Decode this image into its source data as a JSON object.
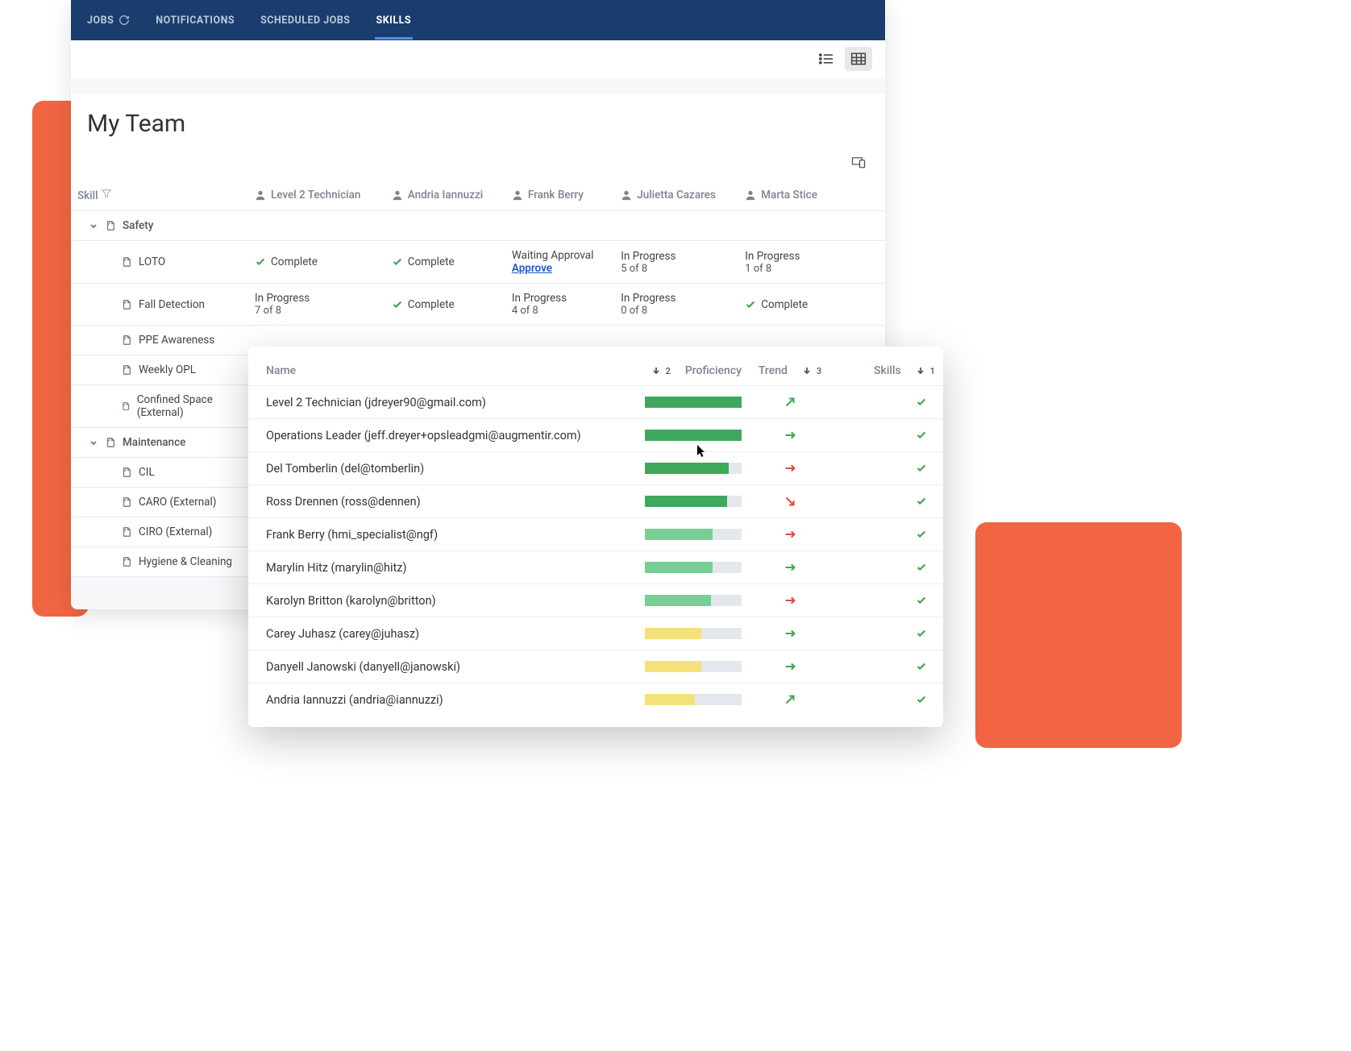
{
  "nav": {
    "items": [
      {
        "label": "JOBS"
      },
      {
        "label": "NOTIFICATIONS"
      },
      {
        "label": "SCHEDULED JOBS"
      },
      {
        "label": "SKILLS"
      }
    ],
    "active_index": 3
  },
  "page": {
    "title": "My Team"
  },
  "skills_table": {
    "headers": {
      "skill": "Skill",
      "people": [
        "Level 2 Technician",
        "Andria Iannuzzi",
        "Frank Berry",
        "Julietta Cazares",
        "Marta Stice"
      ]
    },
    "categories": [
      {
        "name": "Safety",
        "skills": [
          {
            "name": "LOTO",
            "statuses": [
              {
                "type": "complete",
                "label": "Complete"
              },
              {
                "type": "complete",
                "label": "Complete"
              },
              {
                "type": "approval",
                "label": "Waiting Approval",
                "action": "Approve"
              },
              {
                "type": "progress",
                "label": "In Progress",
                "sub": "5 of 8"
              },
              {
                "type": "progress",
                "label": "In Progress",
                "sub": "1 of 8"
              }
            ]
          },
          {
            "name": "Fall Detection",
            "statuses": [
              {
                "type": "progress",
                "label": "In Progress",
                "sub": "7 of 8"
              },
              {
                "type": "complete",
                "label": "Complete"
              },
              {
                "type": "progress",
                "label": "In Progress",
                "sub": "4 of 8"
              },
              {
                "type": "progress",
                "label": "In Progress",
                "sub": "0 of 8"
              },
              {
                "type": "complete",
                "label": "Complete"
              }
            ]
          },
          {
            "name": "PPE Awareness",
            "statuses": []
          },
          {
            "name": "Weekly OPL",
            "statuses": []
          },
          {
            "name": "Confined Space (External)",
            "statuses": []
          }
        ]
      },
      {
        "name": "Maintenance",
        "skills": [
          {
            "name": "CIL",
            "statuses": []
          },
          {
            "name": "CARO (External)",
            "statuses": []
          },
          {
            "name": "CIRO (External)",
            "statuses": []
          },
          {
            "name": "Hygiene & Cleaning",
            "statuses": []
          }
        ]
      }
    ]
  },
  "overlay": {
    "headers": {
      "name": "Name",
      "proficiency": "Proficiency",
      "trend": "Trend",
      "skills": "Skills",
      "sort": {
        "proficiency": "2",
        "trend": "3",
        "skills": "1"
      }
    },
    "rows": [
      {
        "name": "Level 2 Technician (jdreyer90@gmail.com)",
        "pct": 100,
        "color": "greenD",
        "trend": "up",
        "skill_ok": true
      },
      {
        "name": "Operations Leader (jeff.dreyer+opsleadgmi@augmentir.com)",
        "pct": 100,
        "color": "greenD",
        "trend": "flat",
        "skill_ok": true
      },
      {
        "name": "Del Tomberlin (del@tomberlin)",
        "pct": 87,
        "color": "greenD",
        "trend": "flatred",
        "skill_ok": true
      },
      {
        "name": "Ross Drennen (ross@dennen)",
        "pct": 85,
        "color": "greenD",
        "trend": "down",
        "skill_ok": true
      },
      {
        "name": "Frank Berry (hmi_specialist@ngf)",
        "pct": 70,
        "color": "greenL",
        "trend": "flatred",
        "skill_ok": true
      },
      {
        "name": "Marylin Hitz (marylin@hitz)",
        "pct": 70,
        "color": "greenL",
        "trend": "flat",
        "skill_ok": true
      },
      {
        "name": "Karolyn Britton (karolyn@britton)",
        "pct": 68,
        "color": "greenL",
        "trend": "flatred",
        "skill_ok": true
      },
      {
        "name": "Carey Juhasz (carey@juhasz)",
        "pct": 58,
        "color": "yellow",
        "trend": "flat",
        "skill_ok": true
      },
      {
        "name": "Danyell Janowski (danyell@janowski)",
        "pct": 58,
        "color": "yellow",
        "trend": "flat",
        "skill_ok": true
      },
      {
        "name": "Andria Iannuzzi (andria@iannuzzi)",
        "pct": 52,
        "color": "yellow",
        "trend": "up",
        "skill_ok": true
      }
    ]
  }
}
